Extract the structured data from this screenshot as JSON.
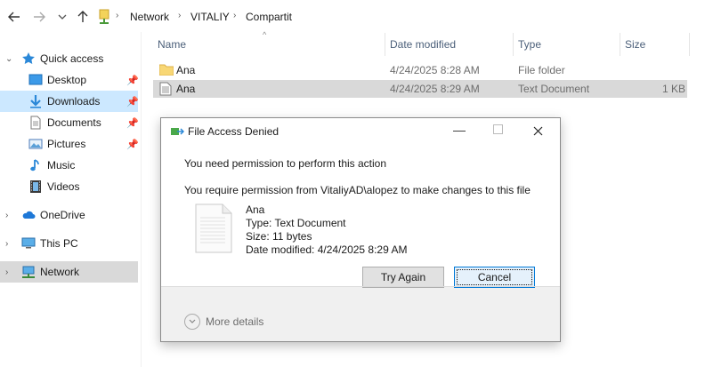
{
  "address": {
    "path": [
      "Network",
      "VITALIY",
      "Compartit"
    ]
  },
  "sidebar": {
    "quick_access": "Quick access",
    "items": [
      {
        "label": "Desktop",
        "icon": "desktop-icon",
        "pinned": true
      },
      {
        "label": "Downloads",
        "icon": "downloads-icon",
        "pinned": true
      },
      {
        "label": "Documents",
        "icon": "documents-icon",
        "pinned": true
      },
      {
        "label": "Pictures",
        "icon": "pictures-icon",
        "pinned": true
      },
      {
        "label": "Music",
        "icon": "music-icon",
        "pinned": false
      },
      {
        "label": "Videos",
        "icon": "videos-icon",
        "pinned": false
      }
    ],
    "onedrive": "OneDrive",
    "this_pc": "This PC",
    "network": "Network"
  },
  "columns": {
    "name": "Name",
    "date_modified": "Date modified",
    "type": "Type",
    "size": "Size"
  },
  "files": [
    {
      "name": "Ana",
      "date": "4/24/2025 8:28 AM",
      "type": "File folder",
      "size": "",
      "icon": "folder-icon"
    },
    {
      "name": "Ana",
      "date": "4/24/2025 8:29 AM",
      "type": "Text Document",
      "size": "1 KB",
      "icon": "text-file-icon",
      "selected": true
    }
  ],
  "dialog": {
    "title": "File Access Denied",
    "heading": "You need permission to perform this action",
    "message": "You require permission from VitaliyAD\\alopez to make changes to this file",
    "file_name": "Ana",
    "file_type": "Type: Text Document",
    "file_size": "Size: 11 bytes",
    "file_date": "Date modified: 4/24/2025 8:29 AM",
    "try_again": "Try Again",
    "cancel": "Cancel",
    "more_details": "More details"
  },
  "colors": {
    "selection": "#cce8ff",
    "selected_row": "#d9d9d9",
    "folder": "#f8d775",
    "accent": "#0078d7"
  }
}
